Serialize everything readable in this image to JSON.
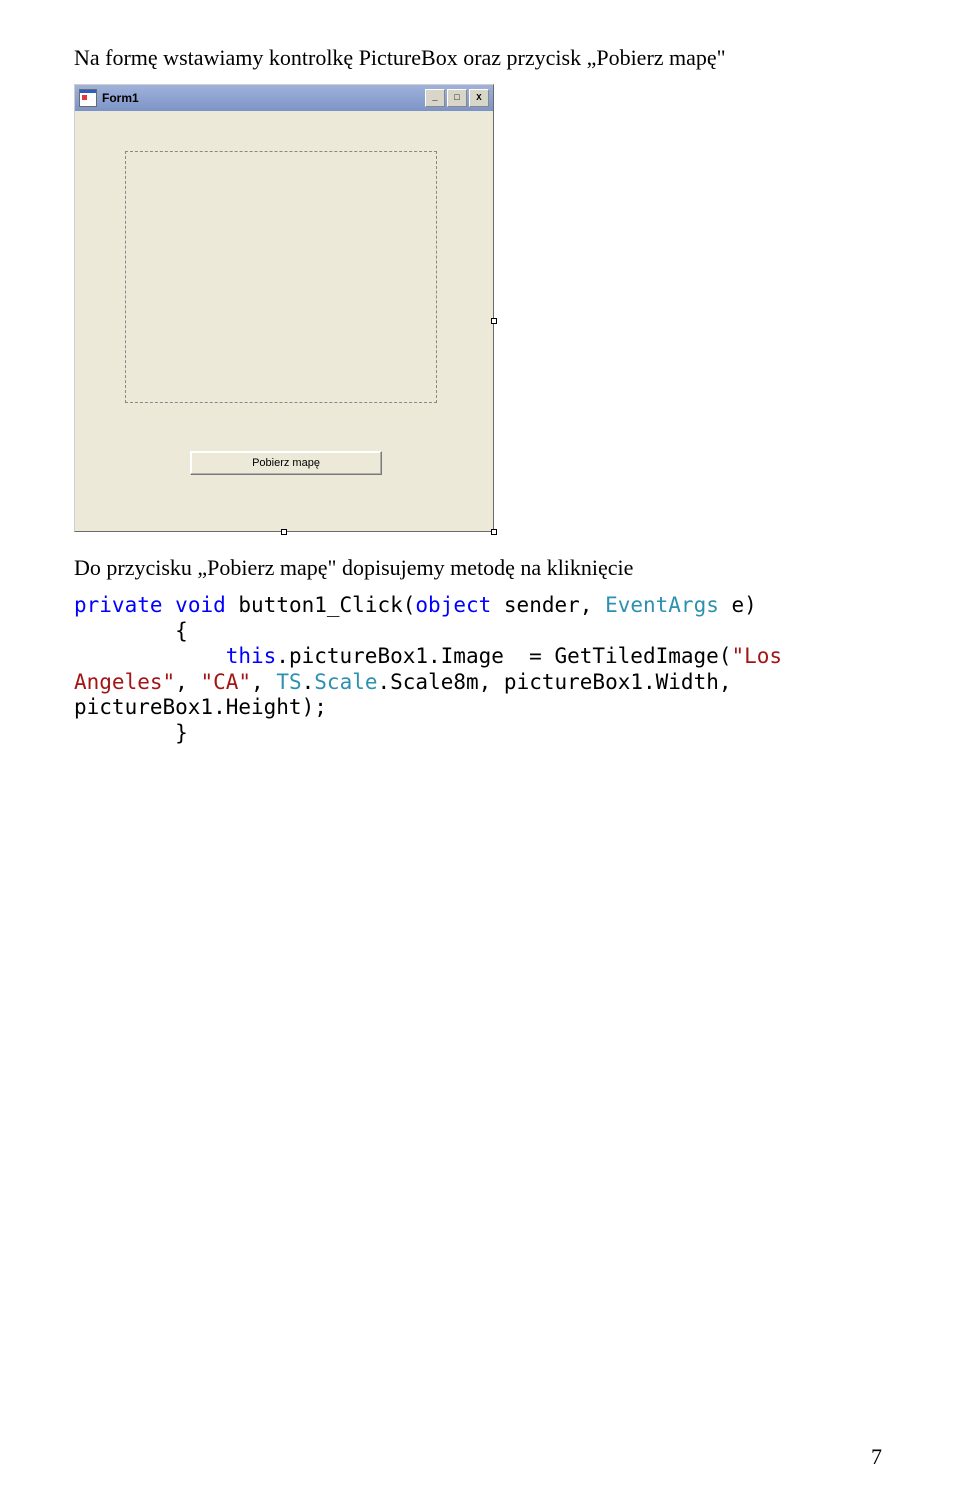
{
  "para1": "Na formę wstawiamy kontrolkę PictureBox oraz przycisk „Pobierz mapę\"",
  "form": {
    "title": "Form1",
    "minimize": "_",
    "maximize": "□",
    "close": "X",
    "button_label": "Pobierz mapę"
  },
  "para2": "Do przycisku „Pobierz mapę\" dopisujemy metodę na kliknięcie",
  "code": {
    "kw_private": "private",
    "kw_void": "void",
    "method": " button1_Click(",
    "kw_object": "object",
    "sender": " sender, ",
    "typ_eventargs": "EventArgs",
    "e_close": " e)",
    "brace_open": "        {",
    "this_call_lead": "            ",
    "kw_this": "this",
    "pb_assign": ".pictureBox1.Image  = GetTiledImage(",
    "str1": "\"Los \n",
    "angeles_line_start": "Angeles\"",
    "comma1": ", ",
    "str2": "\"CA\"",
    "comma2": ", ",
    "typ_ts": "TS",
    "dot_scale": ".",
    "typ_scale": "Scale",
    "rest": ".Scale8m, pictureBox1.Width, ",
    "last_line": "pictureBox1.Height);",
    "brace_close": "        }"
  },
  "pagenum": "7"
}
